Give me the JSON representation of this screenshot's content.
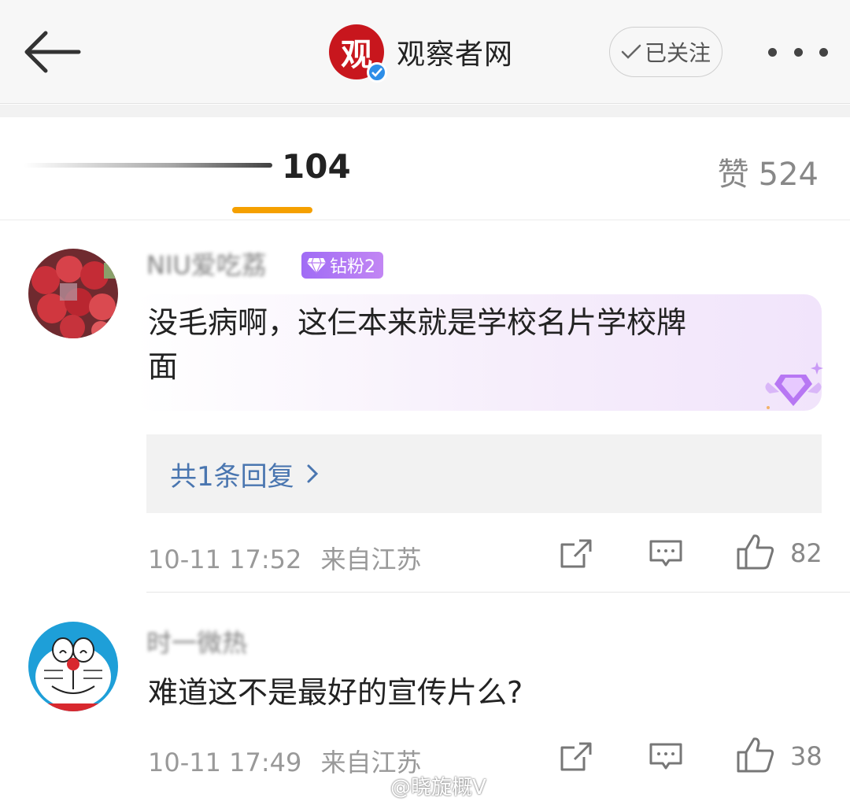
{
  "header": {
    "account_name": "观察者网",
    "logo_glyph": "观",
    "follow_label": "已关注"
  },
  "tabs": {
    "comments_count": "104",
    "likes_label": "赞",
    "likes_count": "524"
  },
  "comments": [
    {
      "username": "NIU爱吃荔",
      "badge": "钻粉2",
      "text_line1": "没毛病啊，这仨本来就是学校名片学校牌",
      "text_line2": "面",
      "replies_label": "共1条回复",
      "time": "10-11 17:52",
      "location": "来自江苏",
      "likes": "82"
    },
    {
      "username": "时一微热",
      "text_line1": "难道这不是最好的宣传片么?",
      "time": "10-11 17:49",
      "location": "来自江苏",
      "likes": "38"
    }
  ],
  "watermark": "@晓旋概V",
  "colors": {
    "accent_orange": "#f5a000",
    "link_blue": "#4a76b0",
    "brand_red": "#c8161d",
    "badge_purple": "#a06cf5"
  }
}
